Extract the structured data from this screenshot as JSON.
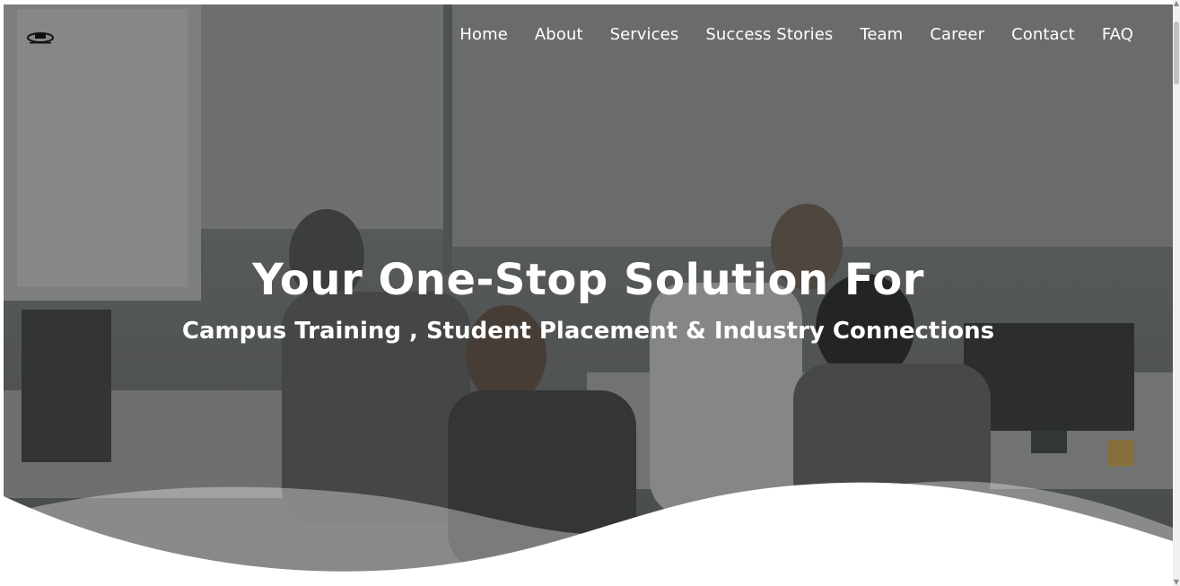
{
  "nav": {
    "items": [
      {
        "label": "Home"
      },
      {
        "label": "About"
      },
      {
        "label": "Services"
      },
      {
        "label": "Success Stories"
      },
      {
        "label": "Team"
      },
      {
        "label": "Career"
      },
      {
        "label": "Contact"
      },
      {
        "label": "FAQ"
      }
    ]
  },
  "hero": {
    "title": "Your One-Stop Solution For",
    "subtitle": "Campus Training , Student Placement & Industry Connections"
  },
  "logo": {
    "icon": "graduation-cap-logo"
  },
  "colors": {
    "text": "#ffffff",
    "overlay": "#2a2c2e",
    "page": "#ffffff"
  }
}
